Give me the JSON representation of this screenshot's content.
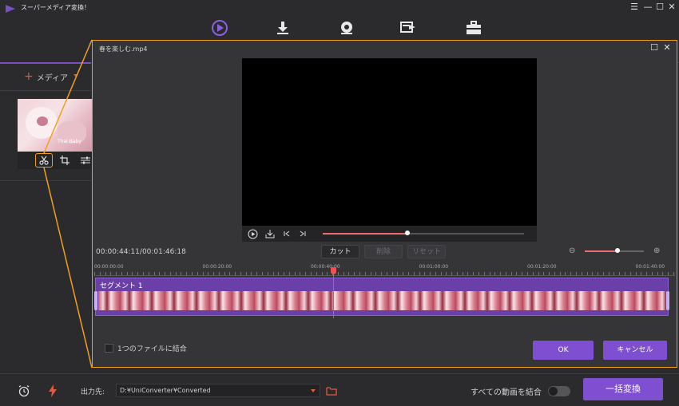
{
  "app": {
    "title": "スーパーメディア変換！"
  },
  "window_controls": {
    "menu": "☰",
    "minimize": "—",
    "maximize": "☐",
    "close": "✕"
  },
  "nav": {
    "icons": [
      "convert-icon",
      "download-icon",
      "record-icon",
      "transfer-icon",
      "toolbox-icon"
    ],
    "accent_color": "#7b4fc4"
  },
  "left_panel": {
    "add_media_label": "メディア",
    "thumbnail_caption": "Thai Baby"
  },
  "dialog": {
    "title": "春を楽しむ.mp4",
    "time_readout": "00:00:44:11/00:01:46:18",
    "buttons": {
      "cut": "カット",
      "delete": "削除",
      "reset": "リセット"
    },
    "ruler_labels": [
      "00:00:00:00",
      "00:00:20:00",
      "00:00:40:00",
      "00:01:00:00",
      "00:01:20:00",
      "00:01:40:00"
    ],
    "segment_label": "セグメント 1",
    "merge_files_label": "1つのファイルに結合",
    "ok_label": "OK",
    "cancel_label": "キャンセル",
    "playback_progress": 0.42,
    "zoom_level": 0.55
  },
  "bottom": {
    "output_label": "出力先:",
    "output_path": "D:¥UniConverter¥Converted",
    "merge_all_label": "すべての動画を結合",
    "merge_all_on": false,
    "convert_all_label": "一括変換"
  },
  "colors": {
    "accent": "#7e4fd0",
    "highlight": "#f0a020",
    "playhead": "#f05050"
  }
}
